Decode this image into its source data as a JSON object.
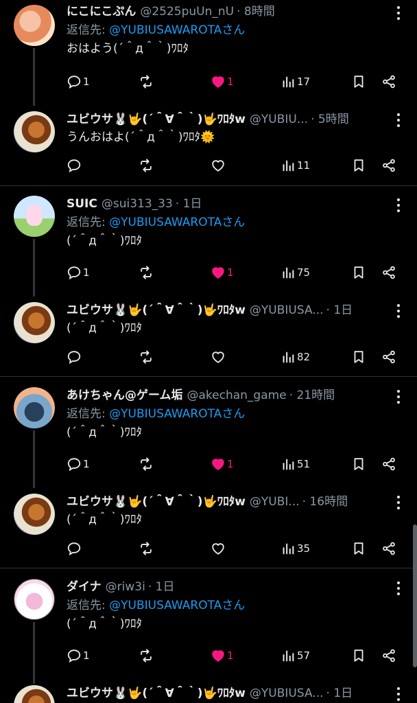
{
  "threads": [
    {
      "parent": {
        "name": "にこにこぷん",
        "handle": "@2525puUn_nU",
        "time": "· 8時間",
        "reply_prefix": "返信先: ",
        "reply_to": "@YUBIUSAWAROTAさん",
        "text": "おはよう(´＾д＾｀)ﾜﾛﾀ",
        "replies": "1",
        "views": "17",
        "likes": "1"
      },
      "reply": {
        "name": "ユビウサ🐰🤟(´＾∀＾｀)🤟ﾜﾛﾀw",
        "handle": "@YUBIU...",
        "time": "· 5時間",
        "text": "うんおはよ(´＾д＾｀)ﾜﾛﾀ🌞",
        "views": "11"
      }
    },
    {
      "parent": {
        "name": "SUIC",
        "handle": "@sui313_33",
        "time": "· 1日",
        "reply_prefix": "返信先: ",
        "reply_to": "@YUBIUSAWAROTAさん",
        "text": "(´＾д＾｀)ﾜﾛﾀ",
        "replies": "1",
        "views": "75",
        "likes": "1"
      },
      "reply": {
        "name": "ユビウサ🐰🤟(´＾∀＾｀)🤟ﾜﾛﾀw",
        "handle": "@YUBIUSA...",
        "time": "· 1日",
        "text": "(´＾д＾｀)ﾜﾛﾀ",
        "views": "82"
      }
    },
    {
      "parent": {
        "name": "あけちゃん@ゲーム垢",
        "handle": "@akechan_game",
        "time": "· 21時間",
        "reply_prefix": "返信先: ",
        "reply_to": "@YUBIUSAWAROTAさん",
        "text": "(´＾д＾｀)ﾜﾛﾀ",
        "replies": "1",
        "views": "51",
        "likes": "1"
      },
      "reply": {
        "name": "ユビウサ🐰🤟(´＾∀＾｀)🤟ﾜﾛﾀw",
        "handle": "@YUBI...",
        "time": "· 16時間",
        "text": "(´＾д＾｀)ﾜﾛﾀ",
        "views": "35"
      }
    },
    {
      "parent": {
        "name": "ダイナ",
        "handle": "@riw3i",
        "time": "· 1日",
        "reply_prefix": "返信先: ",
        "reply_to": "@YUBIUSAWAROTAさん",
        "text": "(´＾д＾｀)ﾜﾛﾀ",
        "replies": "1",
        "views": "57",
        "likes": "1"
      },
      "reply": {
        "name": "ユビウサ🐰🤟(´＾∀＾｀)🤟ﾜﾛﾀw",
        "handle": "@YUBIUSA...",
        "time": "· 1日"
      }
    }
  ],
  "colors": {
    "background": "#000000",
    "like_pink": "#f91880",
    "mention_blue": "#1d9bf0",
    "muted": "#8b98a5"
  },
  "icons": [
    "reply-icon",
    "retweet-icon",
    "like-icon",
    "views-icon",
    "bookmark-icon",
    "share-icon",
    "more-icon"
  ]
}
